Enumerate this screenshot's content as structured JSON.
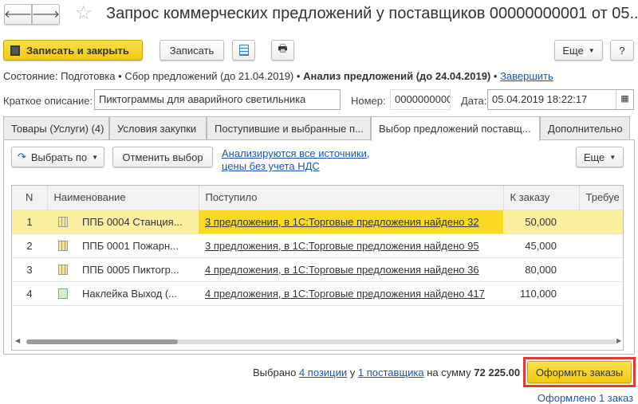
{
  "window": {
    "title": "Запрос коммерческих предложений у поставщиков 00000000001 от 05...."
  },
  "toolbar": {
    "save_close": "Записать и закрыть",
    "save": "Записать",
    "more": "Еще",
    "help": "?"
  },
  "status": {
    "label": "Состояние:",
    "step1": "Подготовка",
    "step2": "Сбор предложений (до 21.04.2019)",
    "step3": "Анализ предложений (до 24.04.2019)",
    "sep": "•",
    "finish": "Завершить"
  },
  "fields": {
    "desc_label": "Краткое описание:",
    "desc_value": "Пиктограммы для аварийного светильника",
    "number_label": "Номер:",
    "number_value": "0000000000",
    "date_label": "Дата:",
    "date_value": "05.04.2019 18:22:17"
  },
  "tabs": [
    "Товары (Услуги) (4)",
    "Условия закупки",
    "Поступившие и выбранные п...",
    "Выбор предложений поставщ...",
    "Дополнительно"
  ],
  "panel": {
    "select_by": "Выбрать по",
    "cancel": "Отменить выбор",
    "info_line1": "Анализируются все источники,",
    "info_line2": "цены без учета НДС",
    "more": "Еще"
  },
  "table": {
    "headers": [
      "N",
      "Наименование",
      "Поступило",
      "К заказу",
      "Требуе"
    ],
    "rows": [
      {
        "n": "1",
        "name": "ППБ 0004 Станция...",
        "received": "3 предложения, в 1С:Торговые предложения найдено 32",
        "qty": "50,000",
        "icon": "grid-icon"
      },
      {
        "n": "2",
        "name": "ППБ 0001 Пожарн...",
        "received": "3 предложения, в 1С:Торговые предложения найдено 95",
        "qty": "45,000",
        "icon": "grid-icon"
      },
      {
        "n": "3",
        "name": "ППБ 0005 Пиктогр...",
        "received": "4 предложения, в 1С:Торговые предложения найдено 36",
        "qty": "80,000",
        "icon": "grid-icon"
      },
      {
        "n": "4",
        "name": "Наклейка Выход (...",
        "received": "4 предложения, в 1С:Торговые предложения найдено 417",
        "qty": "110,000",
        "icon": "sticker-icon"
      }
    ]
  },
  "footer": {
    "selected": "Выбрано",
    "positions": "4 позиции",
    "at": "у",
    "suppliers": "1 поставщика",
    "for_sum": "на сумму",
    "sum": "72 225.00",
    "make_orders": "Оформить заказы",
    "done": "Оформлено 1 заказ"
  },
  "colors": {
    "accent_yellow": "#f9d923",
    "link": "#1c55b0",
    "highlight_border": "#e53935"
  }
}
